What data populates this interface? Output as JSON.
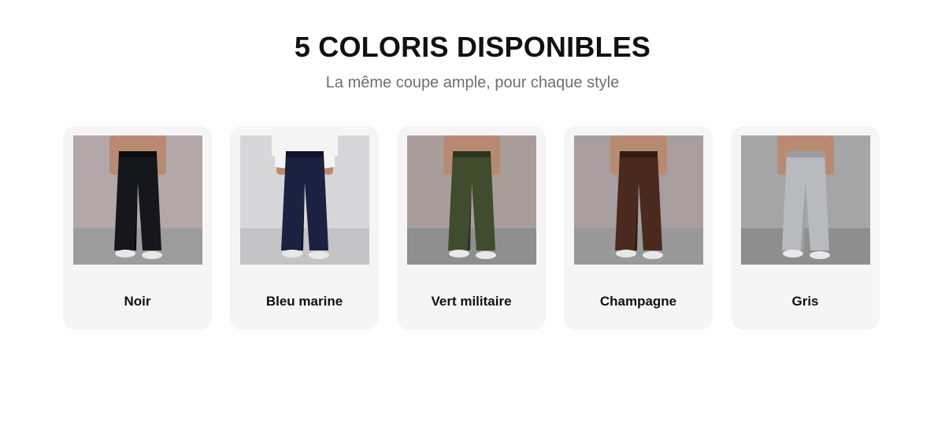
{
  "section": {
    "title": "5 COLORIS DISPONIBLES",
    "subtitle": "La même coupe ample, pour chaque style"
  },
  "colors": [
    {
      "label": "Noir",
      "pant_color": "#15171c",
      "pant_shade": "#0b0c10",
      "background": "#b3a7a9",
      "floor": "#9c9c9c",
      "top": "none"
    },
    {
      "label": "Bleu marine",
      "pant_color": "#1b2140",
      "pant_shade": "#10142a",
      "background": "#d7d7d9",
      "floor": "#c4c4c6",
      "top": "white-tshirt"
    },
    {
      "label": "Vert militaire",
      "pant_color": "#3f4c2e",
      "pant_shade": "#2c361f",
      "background": "#a99d9c",
      "floor": "#8f8f8f",
      "top": "none"
    },
    {
      "label": "Champagne",
      "pant_color": "#4a2a1e",
      "pant_shade": "#331c13",
      "background": "#a89d9f",
      "floor": "#999999",
      "top": "none"
    },
    {
      "label": "Gris",
      "pant_color": "#b9babd",
      "pant_shade": "#9c9da0",
      "background": "#a6a5a5",
      "floor": "#8e8e8e",
      "top": "none"
    }
  ]
}
